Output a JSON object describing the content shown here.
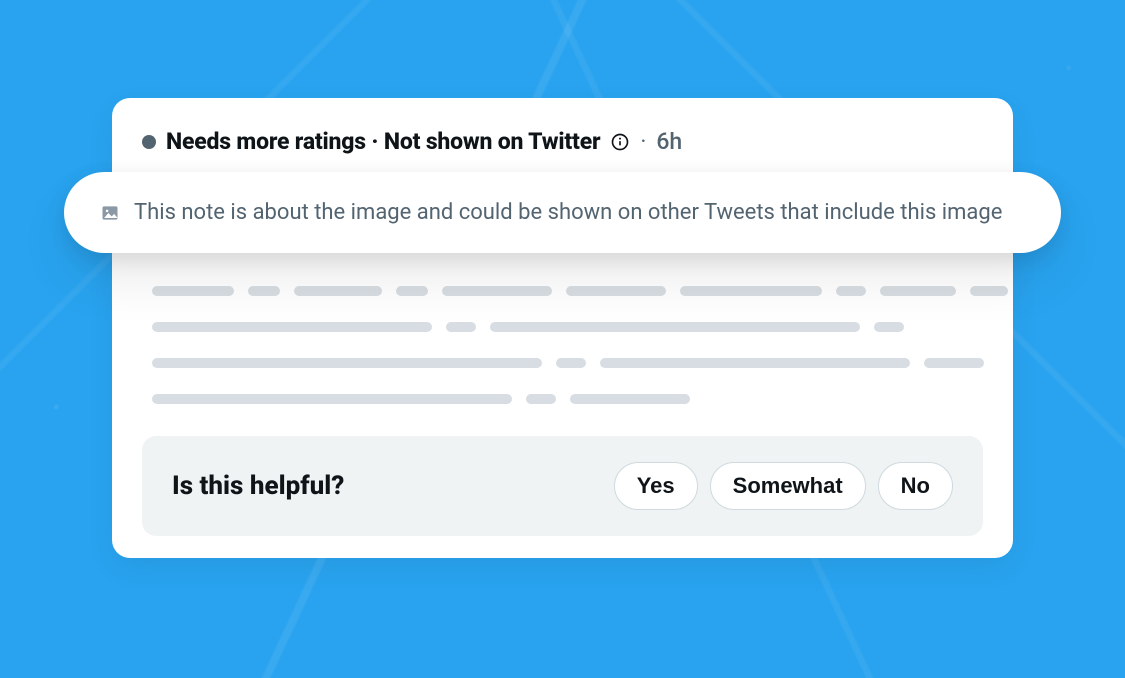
{
  "status": {
    "text": "Needs more ratings · Not shown on Twitter",
    "time": "6h",
    "sep": "·",
    "dot_color": "#536471"
  },
  "pill": {
    "text": "This note is about the image and could be shown on other Tweets that include this image"
  },
  "helpful": {
    "question": "Is this helpful?",
    "yes": "Yes",
    "somewhat": "Somewhat",
    "no": "No"
  },
  "icons": {
    "info": "info-icon",
    "image": "image-icon"
  }
}
